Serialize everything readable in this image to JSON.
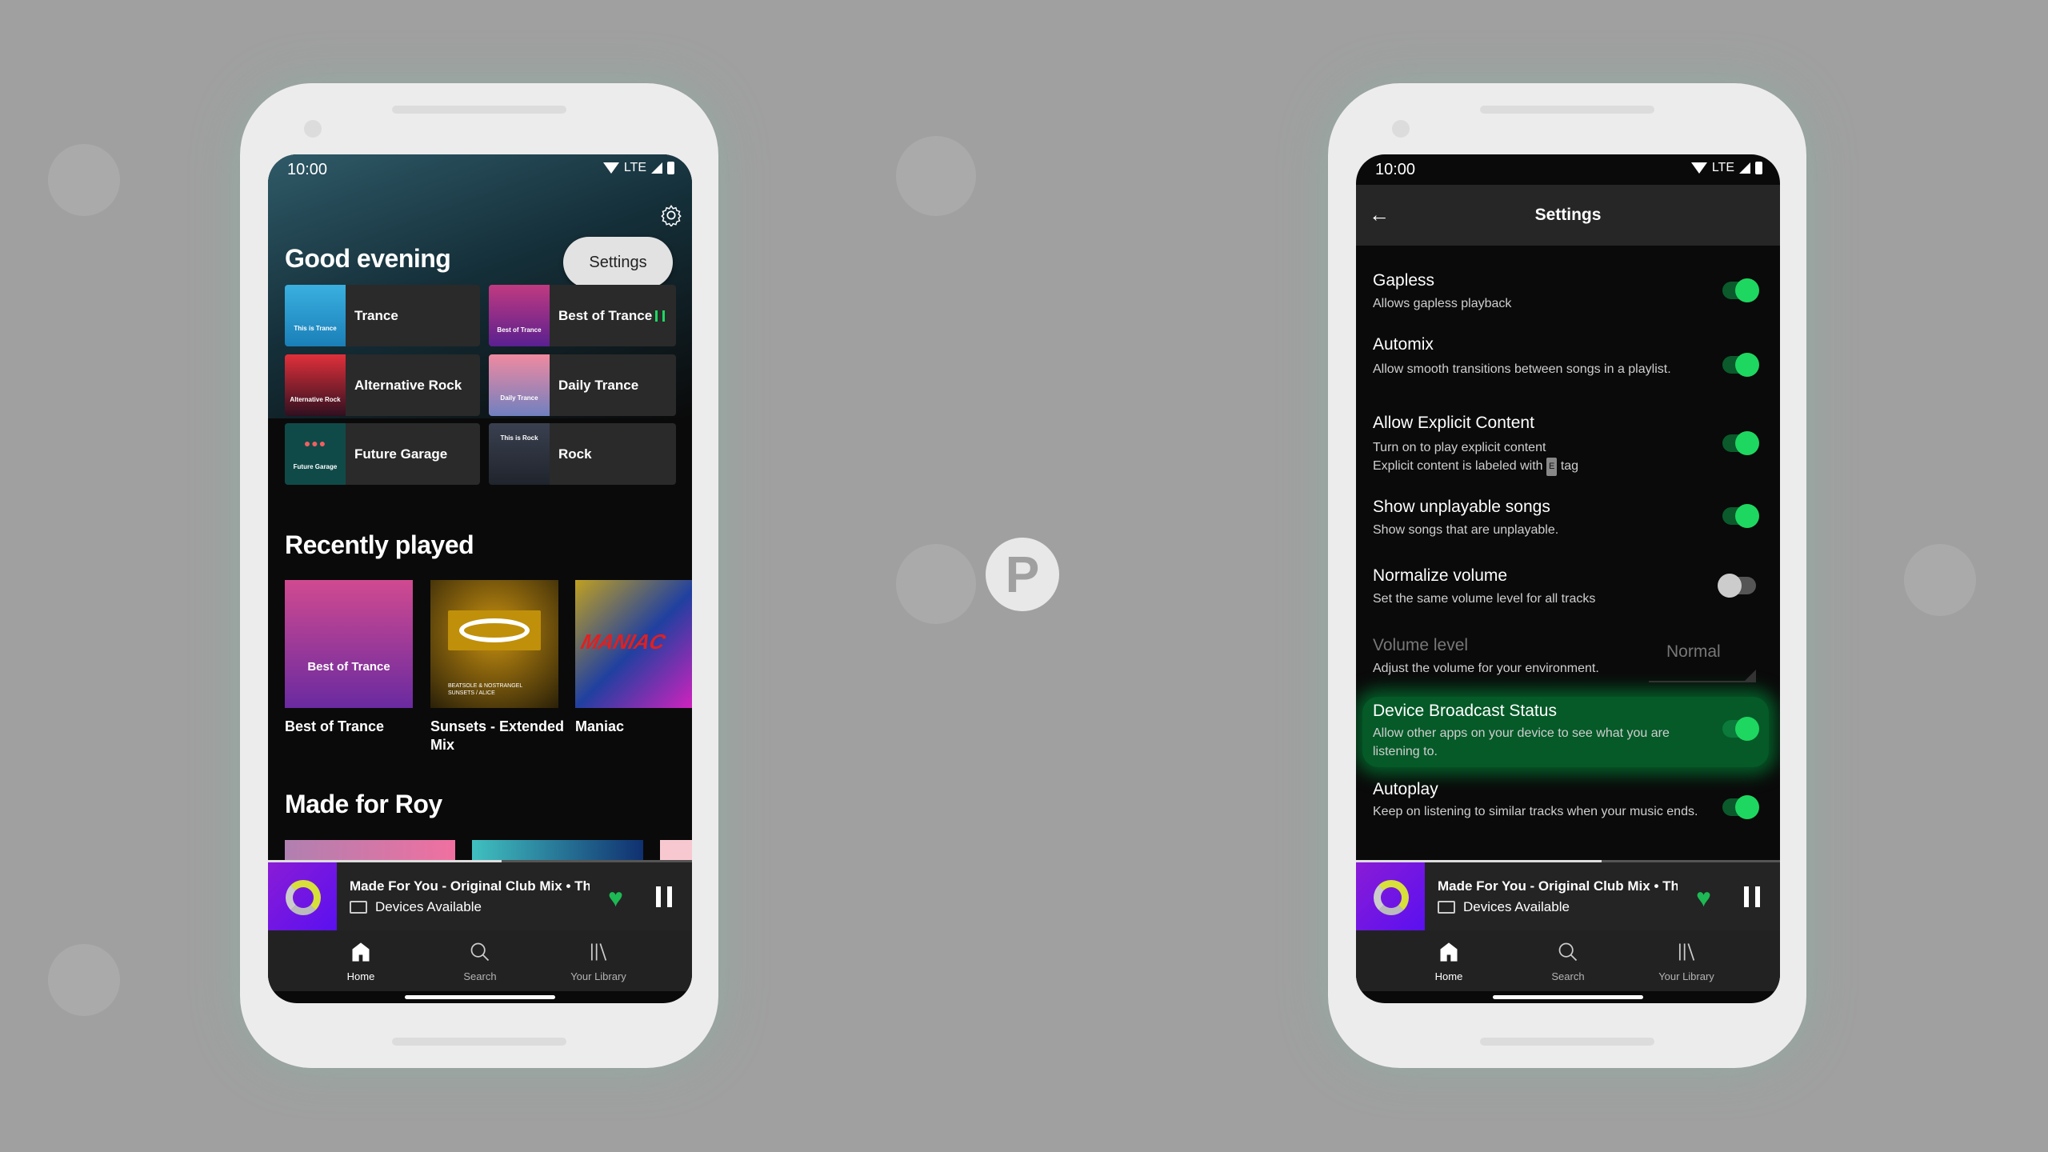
{
  "status_bar": {
    "time": "10:00",
    "network": "LTE"
  },
  "home": {
    "greeting": "Good evening",
    "settings_tooltip": "Settings",
    "shortcuts": [
      {
        "label": "Trance",
        "cover_text": "This is Trance",
        "colors": [
          "#3ab0e0",
          "#1a7fb8"
        ]
      },
      {
        "label": "Best of Trance",
        "cover_text": "Best of Trance",
        "colors": [
          "#c03a80",
          "#5a2090"
        ],
        "playing": true
      },
      {
        "label": "Alternative Rock",
        "cover_text": "Alternative Rock",
        "colors": [
          "#e0303a",
          "#301020"
        ]
      },
      {
        "label": "Daily Trance",
        "cover_text": "Daily Trance",
        "colors": [
          "#f08aa0",
          "#7080c0"
        ]
      },
      {
        "label": "Future Garage",
        "cover_text": "Future Garage",
        "colors": [
          "#0f4a48",
          "#0f3a3a"
        ]
      },
      {
        "label": "Rock",
        "cover_text": "This is Rock",
        "colors": [
          "#3a4050",
          "#20242c"
        ]
      }
    ],
    "recently_played_title": "Recently played",
    "recently_played": [
      {
        "label": "Best of Trance",
        "cover_text": "Best of Trance",
        "colors": [
          "#d04a90",
          "#6a2aa0"
        ]
      },
      {
        "label": "Sunsets - Extended Mix",
        "cover_text": "BEATSOLE & NOSTRANGEL SUNSETS / ALICE",
        "colors": [
          "#c89010",
          "#2a2008"
        ]
      },
      {
        "label": "Maniac",
        "cover_text": "MANIAC",
        "colors": [
          "#2040a0",
          "#c0a020"
        ]
      }
    ],
    "made_for_title": "Made for Roy",
    "made_for_colors": [
      "#e070a0",
      "#40b0c0",
      "#f8c8d0"
    ],
    "now_playing": {
      "title": "Made For You - Original Club Mix • The Blizzard",
      "device": "Devices Available"
    }
  },
  "settings": {
    "title": "Settings",
    "items": [
      {
        "title": "Gapless",
        "subtitle": "Allows gapless playback",
        "on": true
      },
      {
        "title": "Automix",
        "subtitle": "Allow smooth transitions between songs in a playlist.",
        "on": true
      },
      {
        "title": "Allow Explicit Content",
        "subtitle": "Turn on to play explicit content",
        "subtitle2a": "Explicit content is labeled with",
        "tag": "E",
        "subtitle2b": "tag",
        "on": true
      },
      {
        "title": "Show unplayable songs",
        "subtitle": "Show songs that are unplayable.",
        "on": true
      },
      {
        "title": "Normalize volume",
        "subtitle": "Set the same volume level for all tracks",
        "on": false
      },
      {
        "title": "Volume level",
        "subtitle": "Adjust the volume for your environment.",
        "value": "Normal"
      },
      {
        "title": "Device Broadcast Status",
        "subtitle": "Allow other apps on your device to see what you are listening to.",
        "on": true,
        "highlighted": true
      },
      {
        "title": "Autoplay",
        "subtitle": "Keep on listening to similar tracks when your music ends.",
        "on": true
      }
    ],
    "now_playing": {
      "title": "Made For You - Original Club Mix • Th",
      "device": "Devices Available"
    }
  },
  "nav": [
    {
      "label": "Home",
      "icon": "home-icon"
    },
    {
      "label": "Search",
      "icon": "search-icon"
    },
    {
      "label": "Your Library",
      "icon": "library-icon"
    }
  ],
  "accent": "#1ed760"
}
